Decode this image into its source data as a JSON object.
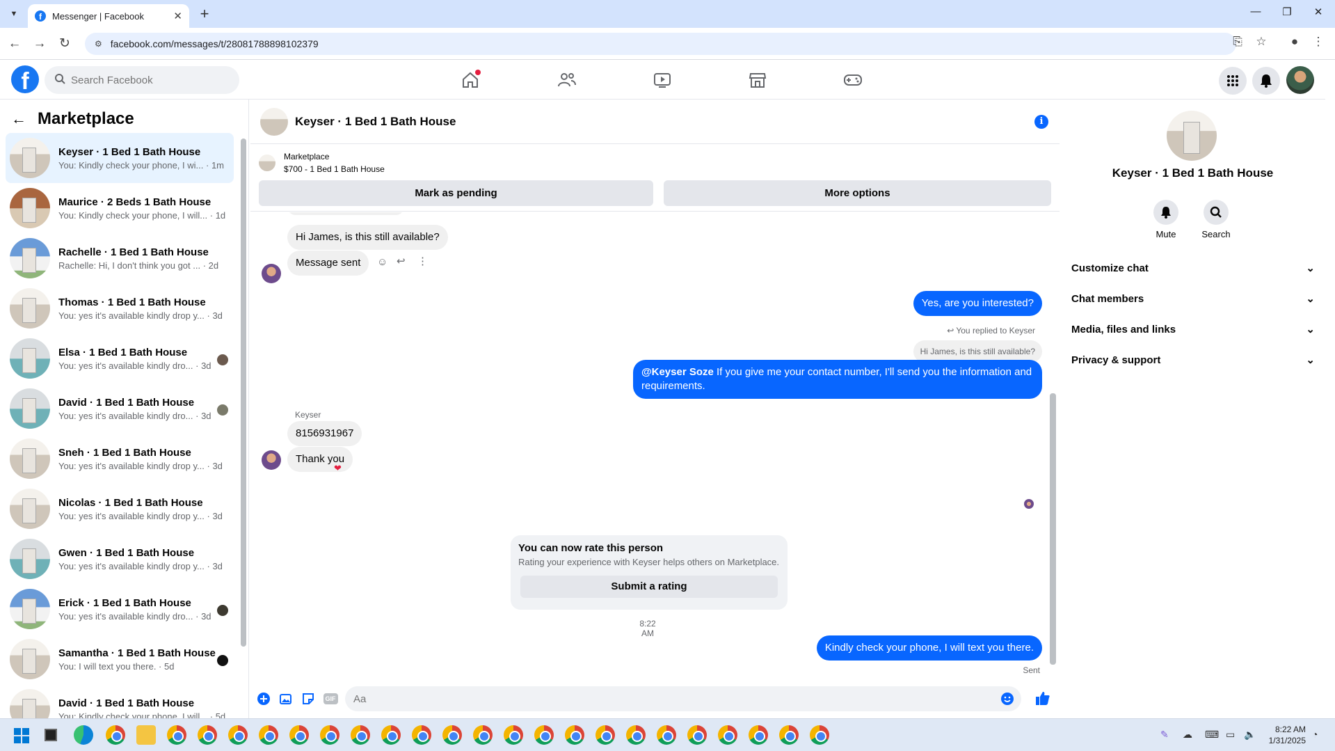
{
  "browser": {
    "tab_title": "Messenger | Facebook",
    "url": "facebook.com/messages/t/28081788898102379"
  },
  "fb": {
    "search_placeholder": "Search Facebook"
  },
  "sidebar": {
    "title": "Marketplace",
    "conversations": [
      {
        "name": "Keyser · 1 Bed 1 Bath House",
        "preview": "You: Kindly check your phone, I wi...",
        "time": "1m"
      },
      {
        "name": "Maurice · 2 Beds 1 Bath House",
        "preview": "You: Kindly check your phone, I will...",
        "time": "1d"
      },
      {
        "name": "Rachelle · 1 Bed 1 Bath House",
        "preview": "Rachelle: Hi, I don't think you got ...",
        "time": "2d"
      },
      {
        "name": "Thomas · 1 Bed 1 Bath House",
        "preview": "You: yes it's available kindly drop y...",
        "time": "3d"
      },
      {
        "name": "Elsa · 1 Bed 1 Bath House",
        "preview": "You: yes it's available kindly dro...",
        "time": "3d"
      },
      {
        "name": "David · 1 Bed 1 Bath House",
        "preview": "You: yes it's available kindly dro...",
        "time": "3d"
      },
      {
        "name": "Sneh · 1 Bed 1 Bath House",
        "preview": "You: yes it's available kindly drop y...",
        "time": "3d"
      },
      {
        "name": "Nicolas · 1 Bed 1 Bath House",
        "preview": "You: yes it's available kindly drop y...",
        "time": "3d"
      },
      {
        "name": "Gwen · 1 Bed 1 Bath House",
        "preview": "You: yes it's available kindly drop y...",
        "time": "3d"
      },
      {
        "name": "Erick · 1 Bed 1 Bath House",
        "preview": "You: yes it's available kindly dro...",
        "time": "3d"
      },
      {
        "name": "Samantha · 1 Bed 1 Bath House",
        "preview": "You: I will text you there.",
        "time": "5d"
      },
      {
        "name": "David · 1 Bed 1 Bath House",
        "preview": "You: Kindly check your phone, I will...",
        "time": "5d"
      }
    ]
  },
  "chat": {
    "title": "Keyser · 1 Bed 1 Bath House",
    "marketplace_label": "Marketplace",
    "listing": "$700 - 1 Bed 1 Bath House",
    "mark_pending": "Mark as pending",
    "more_options": "More options",
    "msg_hi": "Hi James, is this still available?",
    "msg_sent": "Message sent",
    "msg_interested": "Yes, are you interested?",
    "replied_to": "You replied to Keyser",
    "quoted": "Hi James, is this still available?",
    "mention": "@Keyser Soze",
    "msg_contact": " If you give me your contact number, I'll send you the information and requirements.",
    "sender_name": "Keyser",
    "msg_number": "8156931967",
    "msg_thanks": "Thank you",
    "rate_title": "You can now rate this person",
    "rate_desc": "Rating your experience with Keyser helps others on Marketplace.",
    "rate_button": "Submit a rating",
    "timestamp": "8:22 AM",
    "msg_last": "Kindly check your phone, I will text you there.",
    "status": "Sent",
    "compose_placeholder": "Aa",
    "gif_label": "GIF"
  },
  "details": {
    "name": "Keyser · 1 Bed 1 Bath House",
    "mute": "Mute",
    "search": "Search",
    "sections": [
      "Customize chat",
      "Chat members",
      "Media, files and links",
      "Privacy & support"
    ]
  },
  "taskbar": {
    "time": "8:22 AM",
    "date": "1/31/2025"
  },
  "colors": {
    "accent": "#0866ff",
    "fb_blue": "#1877f2",
    "active_conv": "#e7f3ff"
  }
}
